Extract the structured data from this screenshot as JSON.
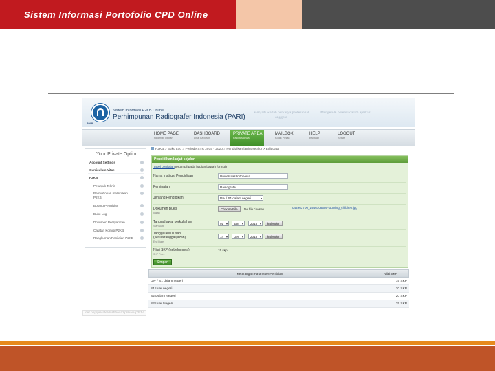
{
  "slide": {
    "title": "Sistem Informasi Portofolio CPD Online",
    "colors": {
      "header_red": "#c11a1f",
      "header_peach": "#f4c6a8",
      "header_dark": "#4d4d4d",
      "footer_orange": "#e68a1e",
      "footer_red": "#bf5428"
    }
  },
  "site": {
    "logo_text": "PARI",
    "small_title": "Sistem Informasi P2KB Online",
    "big_title": "Perhimpunan Radiografer Indonesia (PARI)",
    "slogan1": "Menjadi wadah berkarya profesional anggota",
    "slogan2": "Mengelola potensi dalam aplikasi"
  },
  "nav": [
    {
      "label": "HOME PAGE",
      "sub": "Halaman Depan"
    },
    {
      "label": "DASHBOARD",
      "sub": "Lihat Laporan"
    },
    {
      "label": "PRIVATE AREA",
      "sub": "Fasilitas Anda"
    },
    {
      "label": "MAILBOX",
      "sub": "Kotak Pesan"
    },
    {
      "label": "HELP",
      "sub": "Bantuan"
    },
    {
      "label": "LOGOUT",
      "sub": "Keluar"
    }
  ],
  "sidebar": {
    "title": "Your Private Option",
    "sections": [
      "Account Settings",
      "Curriculum Vitae",
      "P2KB"
    ],
    "items": [
      "Petunjuk Teknis",
      "Permohonan melakukan P2KB",
      "Borang Pengisian",
      "Buku Log",
      "Dokumen Persyaratan",
      "Catatan Komisi P2KB",
      "Rangkuman Penilaian P2KB"
    ]
  },
  "breadcrumb": "P2KB > Buku Log > Periode STR 2015 - 2020 > Pendidikan lanjut sejalur > Edit data",
  "form": {
    "header": "Pendidikan lanjut sejalur",
    "link": "Tabel penilaian",
    "link_rest": "tertampil pada bagian bawah formulir",
    "nama_label": "Nama Institusi Pendidikan",
    "nama_value": "Universitas Indonesia",
    "peminatan_label": "Peminatan",
    "peminatan_value": "Radiografer",
    "jenjang_label": "Jenjang Pendidikan",
    "jenjang_value": "DIV / S1 dalam negeri",
    "dok_label": "Dokumen Bukti",
    "dok_sub": "Ijazah",
    "choose_file": "Choose File",
    "no_file": "No file chosen",
    "file_link": "044963700_1446108586-stunting_children.jpg",
    "awal_label": "Tanggal awal perkuliahan",
    "awal_sub": "Start Date",
    "awal_day": "01",
    "awal_month": "Jan",
    "awal_year": "2015",
    "lulus_label": "Tanggal kelulusan",
    "lulus_label2": "(sesuaitanggalijazah)",
    "lulus_sub": "End Date",
    "lulus_day": "14",
    "lulus_month": "Dec",
    "lulus_year": "2018",
    "kalender": "kalender",
    "skp_label": "Nilai SKP (sebelumnya)",
    "skp_sub": "SKP Point",
    "skp_value": "15 skp",
    "save": "Simpan"
  },
  "table": {
    "col1": "Keterangan Parameter Penilaian",
    "col2": "Nilai SKP",
    "rows": [
      {
        "param": "DIV / S1 dalam negeri",
        "skp": "15 SKP"
      },
      {
        "param": "S1 Luar negeri",
        "skp": "20 SKP"
      },
      {
        "param": "S2 Dalam Negeri",
        "skp": "20 SKP"
      },
      {
        "param": "S2 Luar Negeri",
        "skp": "25 SKP"
      }
    ]
  },
  "status_url": "der.php/private/dashboard/pribadi-p2kb/"
}
